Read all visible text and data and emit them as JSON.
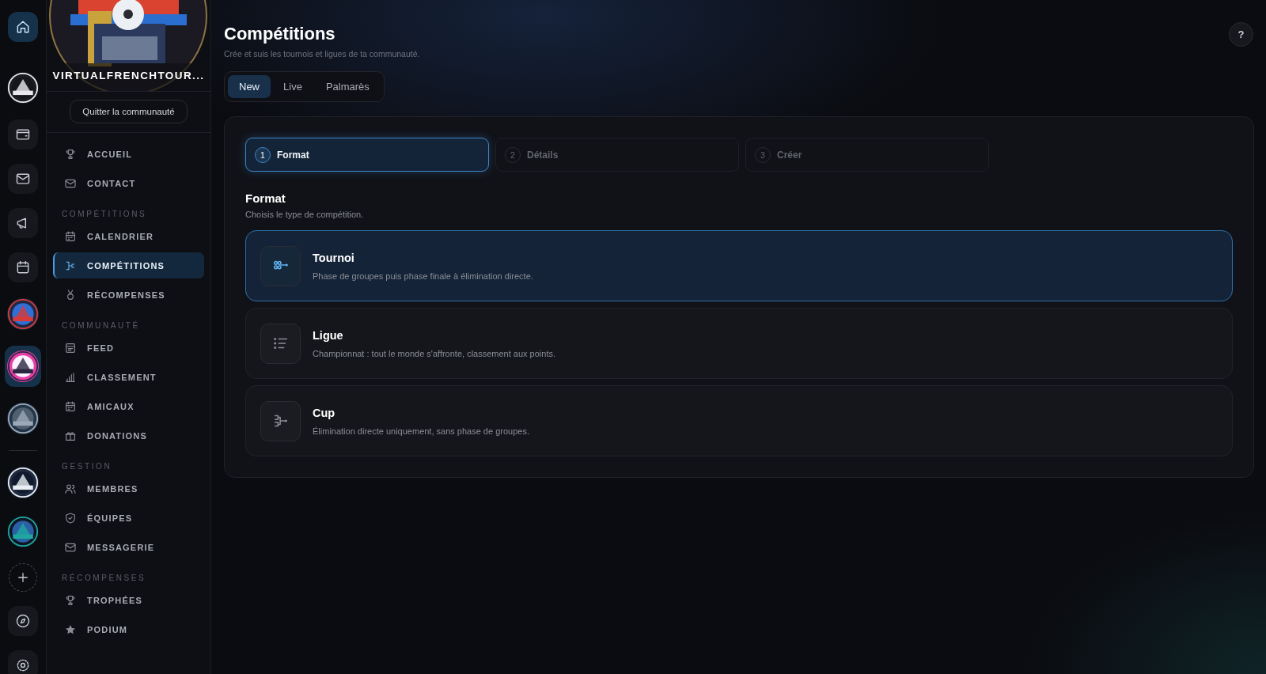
{
  "rail": [
    {
      "kind": "icon",
      "selected": true
    },
    {
      "kind": "picture",
      "selected": false
    },
    {
      "kind": "icon",
      "selected": false
    },
    {
      "kind": "icon",
      "selected": false
    },
    {
      "kind": "icon",
      "selected": false
    },
    {
      "kind": "icon",
      "selected": false
    },
    {
      "kind": "picture",
      "selected": false
    },
    {
      "kind": "picture",
      "selected": true
    },
    {
      "kind": "picture",
      "selected": false
    },
    {
      "kind": "picture",
      "selected": false
    },
    {
      "kind": "picture",
      "selected": false
    },
    {
      "kind": "add",
      "selected": false
    },
    {
      "kind": "icon",
      "selected": false
    },
    {
      "kind": "icon",
      "selected": false
    }
  ],
  "community": {
    "name": "VIRTUALFRENCHTOUR...",
    "leave_button": "Quitter la communauté"
  },
  "sidebar": {
    "sections": [
      {
        "items": [
          {
            "label": "ACCUEIL",
            "selected": false
          },
          {
            "label": "CONTACT",
            "selected": false
          }
        ]
      },
      {
        "title": "COMPÉTITIONS",
        "items": [
          {
            "label": "CALENDRIER",
            "selected": false
          },
          {
            "label": "COMPÉTITIONS",
            "selected": true
          },
          {
            "label": "RÉCOMPENSES",
            "selected": false
          }
        ]
      },
      {
        "title": "COMMUNAUTÉ",
        "items": [
          {
            "label": "FEED",
            "selected": false
          },
          {
            "label": "CLASSEMENT",
            "selected": false
          },
          {
            "label": "AMICAUX",
            "selected": false
          },
          {
            "label": "DONATIONS",
            "selected": false
          }
        ]
      },
      {
        "title": "GESTION",
        "items": [
          {
            "label": "MEMBRES",
            "selected": false
          },
          {
            "label": "ÉQUIPES",
            "selected": false
          },
          {
            "label": "MESSAGERIE",
            "selected": false
          }
        ]
      },
      {
        "title": "RÉCOMPENSES",
        "items": [
          {
            "label": "TROPHÉES",
            "selected": false
          },
          {
            "label": "PODIUM",
            "selected": false
          }
        ]
      }
    ]
  },
  "header": {
    "title": "Compétitions",
    "subtitle": "Crée et suis les tournois et ligues de ta communauté.",
    "help": "?"
  },
  "tabs": [
    {
      "label": "New",
      "selected": true
    },
    {
      "label": "Live",
      "selected": false
    },
    {
      "label": "Palmarès",
      "selected": false
    }
  ],
  "steps": [
    {
      "number": "1",
      "label": "Format",
      "selected": true
    },
    {
      "number": "2",
      "label": "Détails",
      "selected": false
    },
    {
      "number": "3",
      "label": "Créer",
      "selected": false
    }
  ],
  "format": {
    "title": "Format",
    "subtitle": "Choisis le type de compétition.",
    "options": [
      {
        "title": "Tournoi",
        "description": "Phase de groupes puis phase finale à élimination directe.",
        "selected": true
      },
      {
        "title": "Ligue",
        "description": "Championnat : tout le monde s'affronte, classement aux points.",
        "selected": false
      },
      {
        "title": "Cup",
        "description": "Élimination directe uniquement, sans phase de groupes.",
        "selected": false
      }
    ]
  }
}
